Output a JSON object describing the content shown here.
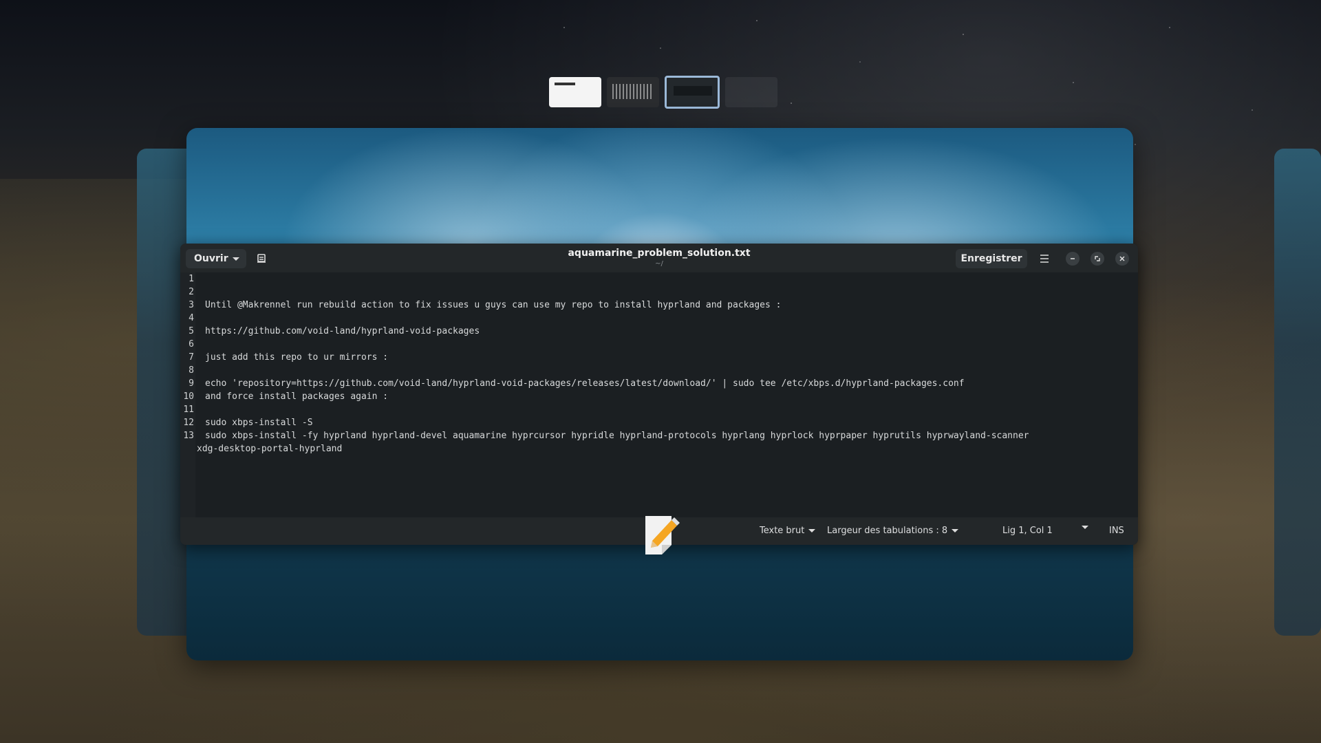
{
  "workspaces": [
    {
      "name": "workspace-1",
      "active": false
    },
    {
      "name": "workspace-2",
      "active": false
    },
    {
      "name": "workspace-3",
      "active": true
    },
    {
      "name": "workspace-4",
      "active": false
    }
  ],
  "editor": {
    "title": "aquamarine_problem_solution.txt",
    "subtitle": "~/",
    "open_label": "Ouvrir",
    "save_label": "Enregistrer",
    "icons": {
      "open_dropdown": "chevron-down-icon",
      "document": "document-icon",
      "menu": "hamburger-menu-icon",
      "minimize": "minimize-icon",
      "maximize": "maximize-icon",
      "close": "close-icon"
    },
    "lines": [
      {
        "num": "1",
        "text": ""
      },
      {
        "num": "2",
        "text": ""
      },
      {
        "num": "3",
        "text": "Until @Makrennel run rebuild action to fix issues u guys can use my repo to install hyprland and packages :"
      },
      {
        "num": "4",
        "text": ""
      },
      {
        "num": "5",
        "text": "https://github.com/void-land/hyprland-void-packages"
      },
      {
        "num": "6",
        "text": ""
      },
      {
        "num": "7",
        "text": "just add this repo to ur mirrors :"
      },
      {
        "num": "8",
        "text": ""
      },
      {
        "num": "9",
        "text": "echo 'repository=https://github.com/void-land/hyprland-void-packages/releases/latest/download/' | sudo tee /etc/xbps.d/hyprland-packages.conf"
      },
      {
        "num": "10",
        "text": "and force install packages again :"
      },
      {
        "num": "11",
        "text": ""
      },
      {
        "num": "12",
        "text": "sudo xbps-install -S"
      },
      {
        "num": "13",
        "text": "sudo xbps-install -fy hyprland hyprland-devel aquamarine hyprcursor hypridle hyprland-protocols hyprlang hyprlock hyprpaper hyprutils hyprwayland-scanner"
      }
    ],
    "wrap_line": "xdg-desktop-portal-hyprland",
    "status": {
      "language": "Texte brut",
      "tab_width": "Largeur des tabulations : 8",
      "position": "Lig 1, Col 1",
      "mode": "INS"
    }
  },
  "dock_icon": "text-editor-icon",
  "colors": {
    "editor_bg": "#1f2326",
    "header_bg": "#232729",
    "text": "#d8dadb",
    "accent_border": "#9bb9d8"
  }
}
